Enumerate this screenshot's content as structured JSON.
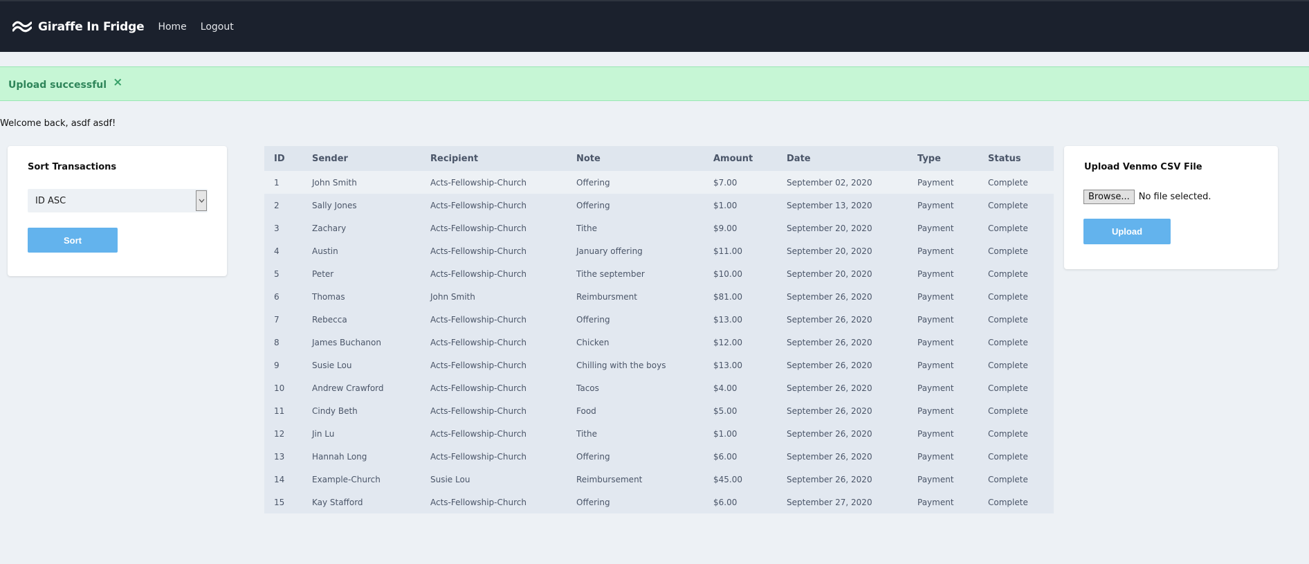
{
  "navbar": {
    "brand": "Giraffe In Fridge",
    "links": [
      "Home",
      "Logout"
    ]
  },
  "alert": {
    "message": "Upload successful",
    "close_glyph": "×"
  },
  "welcome": "Welcome back, asdf asdf!",
  "sort_card": {
    "title": "Sort Transactions",
    "selected_option": "ID ASC",
    "button_label": "Sort"
  },
  "upload_card": {
    "title": "Upload Venmo CSV File",
    "browse_label": "Browse...",
    "file_status": "No file selected.",
    "button_label": "Upload"
  },
  "table": {
    "columns": [
      "ID",
      "Sender",
      "Recipient",
      "Note",
      "Amount",
      "Date",
      "Type",
      "Status"
    ],
    "rows": [
      [
        "1",
        "John Smith",
        "Acts-Fellowship-Church",
        "Offering",
        "$7.00",
        "September 02, 2020",
        "Payment",
        "Complete"
      ],
      [
        "2",
        "Sally Jones",
        "Acts-Fellowship-Church",
        "Offering",
        "$1.00",
        "September 13, 2020",
        "Payment",
        "Complete"
      ],
      [
        "3",
        "Zachary",
        "Acts-Fellowship-Church",
        "Tithe",
        "$9.00",
        "September 20, 2020",
        "Payment",
        "Complete"
      ],
      [
        "4",
        "Austin",
        "Acts-Fellowship-Church",
        "January offering",
        "$11.00",
        "September 20, 2020",
        "Payment",
        "Complete"
      ],
      [
        "5",
        "Peter",
        "Acts-Fellowship-Church",
        "Tithe september",
        "$10.00",
        "September 20, 2020",
        "Payment",
        "Complete"
      ],
      [
        "6",
        "Thomas",
        "John Smith",
        "Reimbursment",
        "$81.00",
        "September 26, 2020",
        "Payment",
        "Complete"
      ],
      [
        "7",
        "Rebecca",
        "Acts-Fellowship-Church",
        "Offering",
        "$13.00",
        "September 26, 2020",
        "Payment",
        "Complete"
      ],
      [
        "8",
        "James Buchanon",
        "Acts-Fellowship-Church",
        "Chicken",
        "$12.00",
        "September 26, 2020",
        "Payment",
        "Complete"
      ],
      [
        "9",
        "Susie Lou",
        "Acts-Fellowship-Church",
        "Chilling with the boys",
        "$13.00",
        "September 26, 2020",
        "Payment",
        "Complete"
      ],
      [
        "10",
        "Andrew Crawford",
        "Acts-Fellowship-Church",
        "Tacos",
        "$4.00",
        "September 26, 2020",
        "Payment",
        "Complete"
      ],
      [
        "11",
        "Cindy Beth",
        "Acts-Fellowship-Church",
        "Food",
        "$5.00",
        "September 26, 2020",
        "Payment",
        "Complete"
      ],
      [
        "12",
        "Jin Lu",
        "Acts-Fellowship-Church",
        "Tithe",
        "$1.00",
        "September 26, 2020",
        "Payment",
        "Complete"
      ],
      [
        "13",
        "Hannah Long",
        "Acts-Fellowship-Church",
        "Offering",
        "$6.00",
        "September 26, 2020",
        "Payment",
        "Complete"
      ],
      [
        "14",
        "Example-Church",
        "Susie Lou",
        "Reimbursement",
        "$45.00",
        "September 26, 2020",
        "Payment",
        "Complete"
      ],
      [
        "15",
        "Kay Stafford",
        "Acts-Fellowship-Church",
        "Offering",
        "$6.00",
        "September 27, 2020",
        "Payment",
        "Complete"
      ]
    ]
  },
  "colors": {
    "navbar_bg": "#1b212d",
    "page_bg": "#edf1f5",
    "alert_bg": "#c6f6d5",
    "alert_text": "#2f855a",
    "button_bg": "#63b3ed",
    "table_row": "#e2e8f0"
  },
  "icons": {
    "brand": "wave-logo-icon",
    "select_arrow": "chevron-down-icon",
    "alert_close": "close-icon"
  }
}
